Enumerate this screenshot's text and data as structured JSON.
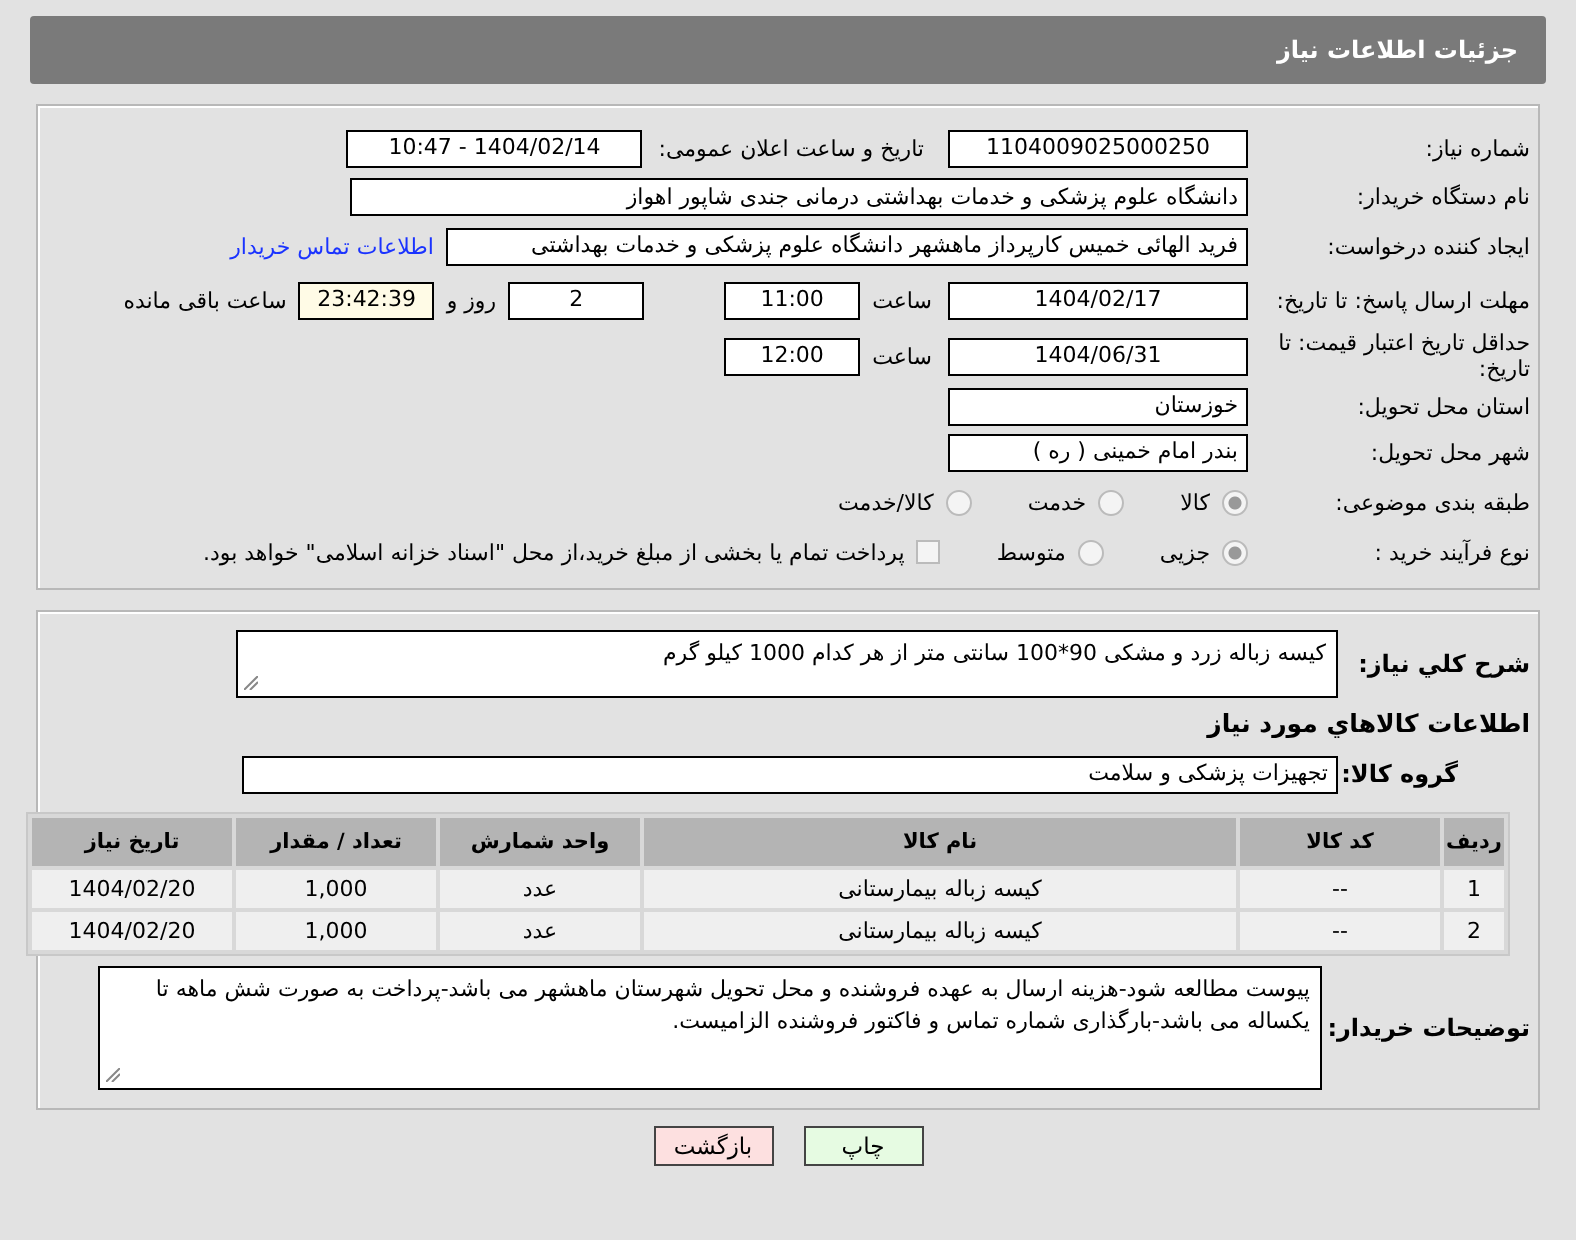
{
  "header": {
    "title": "جزئیات اطلاعات نیاز"
  },
  "need_number": {
    "label": "شماره نیاز:",
    "value": "1104009025000250"
  },
  "announce": {
    "label": "تاریخ و ساعت اعلان عمومی:",
    "value": "1404/02/14 - 10:47"
  },
  "buyer": {
    "label": "نام دستگاه خریدار:",
    "value": "دانشگاه علوم پزشکی و خدمات بهداشتی درمانی جندی شاپور اهواز"
  },
  "creator": {
    "label": "ایجاد کننده درخواست:",
    "value": "فرید الهائی خمیس کارپرداز ماهشهر دانشگاه علوم پزشکی و خدمات بهداشتی",
    "link": "اطلاعات تماس خریدار"
  },
  "deadline": {
    "label": "مهلت ارسال پاسخ: تا تاریخ:",
    "date": "1404/02/17",
    "time_label": "ساعت",
    "time": "11:00",
    "days": "2",
    "days_label": "روز و",
    "remaining": "23:42:39",
    "remaining_label": "ساعت باقی مانده"
  },
  "validity": {
    "label": "حداقل تاریخ اعتبار قیمت: تا تاریخ:",
    "date": "1404/06/31",
    "time_label": "ساعت",
    "time": "12:00"
  },
  "province": {
    "label": "استان محل تحویل:",
    "value": "خوزستان"
  },
  "city": {
    "label": "شهر محل تحویل:",
    "value": "بندر امام خمینی ( ره )"
  },
  "category": {
    "label": "طبقه بندی موضوعی:",
    "options": [
      {
        "label": "کالا",
        "selected": true
      },
      {
        "label": "خدمت",
        "selected": false
      },
      {
        "label": "کالا/خدمت",
        "selected": false
      }
    ]
  },
  "process": {
    "label": "نوع فرآیند خرید :",
    "options": [
      {
        "label": "جزیی",
        "selected": true
      },
      {
        "label": "متوسط",
        "selected": false
      }
    ],
    "treasury": {
      "label": "پرداخت تمام یا بخشی از مبلغ خرید،از محل \"اسناد خزانه اسلامی\" خواهد بود.",
      "checked": false
    }
  },
  "description": {
    "label": "شرح کلي نياز:",
    "value": "کیسه زباله زرد و مشکی 90*100 سانتی متر از هر کدام 1000 کیلو گرم"
  },
  "goods_heading": "اطلاعات کالاهاي مورد نياز",
  "goods_group": {
    "label": "گروه کالا:",
    "value": "تجهیزات پزشکی و سلامت"
  },
  "table": {
    "columns": [
      "رديف",
      "کد کالا",
      "نام کالا",
      "واحد شمارش",
      "تعداد / مقدار",
      "تاريخ نياز"
    ],
    "rows": [
      [
        "1",
        "--",
        "کیسه زباله بیمارستانی",
        "عدد",
        "1,000",
        "1404/02/20"
      ],
      [
        "2",
        "--",
        "کیسه زباله بیمارستانی",
        "عدد",
        "1,000",
        "1404/02/20"
      ]
    ]
  },
  "notes": {
    "label": "توضیحات خریدار:",
    "value": "پیوست مطالعه شود-هزینه ارسال به عهده فروشنده و محل تحویل شهرستان ماهشهر می باشد-پرداخت به صورت شش ماهه تا یکساله می باشد-بارگذاری شماره تماس و فاکتور فروشنده الزامیست."
  },
  "buttons": [
    {
      "label": "چاپ",
      "kind": "print"
    },
    {
      "label": "بازگشت",
      "kind": "back"
    }
  ]
}
